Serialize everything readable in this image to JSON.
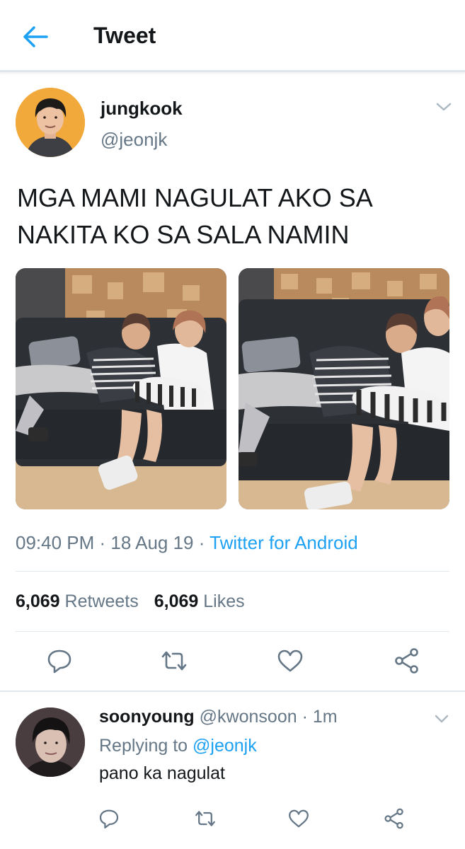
{
  "header": {
    "title": "Tweet",
    "back_icon": "arrow-left-icon",
    "accent": "#1da1f2"
  },
  "tweet": {
    "author_name": "jungkook",
    "author_handle": "@jeonjk",
    "text": "MGA MAMI NAGULAT AKO SA NAKITA KO SA SALA NAMIN",
    "time": "09:40 PM",
    "date": "18 Aug 19",
    "separator": " · ",
    "source": "Twitter for Android",
    "retweets_count": "6,069",
    "retweets_label": "Retweets",
    "likes_count": "6,069",
    "likes_label": "Likes",
    "photos": [
      "photo-1",
      "photo-2"
    ]
  },
  "actions": [
    "reply-icon",
    "retweet-icon",
    "like-icon",
    "share-icon"
  ],
  "reply": {
    "author_name": "soonyoung",
    "author_handle": "@kwonsoon",
    "time": "1m",
    "separator": " · ",
    "replying_label": "Replying to",
    "replying_handle": "@jeonjk",
    "text": "pano ka nagulat"
  },
  "colors": {
    "text": "#14171a",
    "secondary": "#657786",
    "link": "#1da1f2",
    "divider": "#e1e8ed"
  }
}
